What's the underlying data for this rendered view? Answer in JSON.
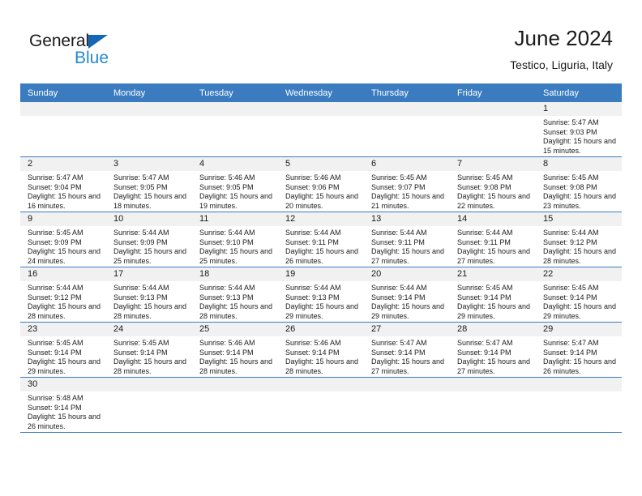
{
  "brand": {
    "name_top": "General",
    "name_bottom": "Blue",
    "triangle_color": "#1567b5",
    "blue_color": "#2389d6"
  },
  "header": {
    "title": "June 2024",
    "subtitle": "Testico, Liguria, Italy"
  },
  "theme": {
    "header_bg": "#3b7cc0",
    "header_text": "#ffffff",
    "daynum_band_bg": "#f1f1f1",
    "row_border": "#3b7cc0",
    "body_text": "#1a1a1a"
  },
  "weekday_headers": [
    "Sunday",
    "Monday",
    "Tuesday",
    "Wednesday",
    "Thursday",
    "Friday",
    "Saturday"
  ],
  "labels": {
    "sunrise_prefix": "Sunrise:",
    "sunset_prefix": "Sunset:",
    "daylight_prefix": "Daylight:"
  },
  "weeks": [
    [
      {
        "empty": true
      },
      {
        "empty": true
      },
      {
        "empty": true
      },
      {
        "empty": true
      },
      {
        "empty": true
      },
      {
        "empty": true
      },
      {
        "day": "1",
        "sunrise": "Sunrise: 5:47 AM",
        "sunset": "Sunset: 9:03 PM",
        "daylight": "Daylight: 15 hours and 15 minutes."
      }
    ],
    [
      {
        "day": "2",
        "sunrise": "Sunrise: 5:47 AM",
        "sunset": "Sunset: 9:04 PM",
        "daylight": "Daylight: 15 hours and 16 minutes."
      },
      {
        "day": "3",
        "sunrise": "Sunrise: 5:47 AM",
        "sunset": "Sunset: 9:05 PM",
        "daylight": "Daylight: 15 hours and 18 minutes."
      },
      {
        "day": "4",
        "sunrise": "Sunrise: 5:46 AM",
        "sunset": "Sunset: 9:05 PM",
        "daylight": "Daylight: 15 hours and 19 minutes."
      },
      {
        "day": "5",
        "sunrise": "Sunrise: 5:46 AM",
        "sunset": "Sunset: 9:06 PM",
        "daylight": "Daylight: 15 hours and 20 minutes."
      },
      {
        "day": "6",
        "sunrise": "Sunrise: 5:45 AM",
        "sunset": "Sunset: 9:07 PM",
        "daylight": "Daylight: 15 hours and 21 minutes."
      },
      {
        "day": "7",
        "sunrise": "Sunrise: 5:45 AM",
        "sunset": "Sunset: 9:08 PM",
        "daylight": "Daylight: 15 hours and 22 minutes."
      },
      {
        "day": "8",
        "sunrise": "Sunrise: 5:45 AM",
        "sunset": "Sunset: 9:08 PM",
        "daylight": "Daylight: 15 hours and 23 minutes."
      }
    ],
    [
      {
        "day": "9",
        "sunrise": "Sunrise: 5:45 AM",
        "sunset": "Sunset: 9:09 PM",
        "daylight": "Daylight: 15 hours and 24 minutes."
      },
      {
        "day": "10",
        "sunrise": "Sunrise: 5:44 AM",
        "sunset": "Sunset: 9:09 PM",
        "daylight": "Daylight: 15 hours and 25 minutes."
      },
      {
        "day": "11",
        "sunrise": "Sunrise: 5:44 AM",
        "sunset": "Sunset: 9:10 PM",
        "daylight": "Daylight: 15 hours and 25 minutes."
      },
      {
        "day": "12",
        "sunrise": "Sunrise: 5:44 AM",
        "sunset": "Sunset: 9:11 PM",
        "daylight": "Daylight: 15 hours and 26 minutes."
      },
      {
        "day": "13",
        "sunrise": "Sunrise: 5:44 AM",
        "sunset": "Sunset: 9:11 PM",
        "daylight": "Daylight: 15 hours and 27 minutes."
      },
      {
        "day": "14",
        "sunrise": "Sunrise: 5:44 AM",
        "sunset": "Sunset: 9:11 PM",
        "daylight": "Daylight: 15 hours and 27 minutes."
      },
      {
        "day": "15",
        "sunrise": "Sunrise: 5:44 AM",
        "sunset": "Sunset: 9:12 PM",
        "daylight": "Daylight: 15 hours and 28 minutes."
      }
    ],
    [
      {
        "day": "16",
        "sunrise": "Sunrise: 5:44 AM",
        "sunset": "Sunset: 9:12 PM",
        "daylight": "Daylight: 15 hours and 28 minutes."
      },
      {
        "day": "17",
        "sunrise": "Sunrise: 5:44 AM",
        "sunset": "Sunset: 9:13 PM",
        "daylight": "Daylight: 15 hours and 28 minutes."
      },
      {
        "day": "18",
        "sunrise": "Sunrise: 5:44 AM",
        "sunset": "Sunset: 9:13 PM",
        "daylight": "Daylight: 15 hours and 28 minutes."
      },
      {
        "day": "19",
        "sunrise": "Sunrise: 5:44 AM",
        "sunset": "Sunset: 9:13 PM",
        "daylight": "Daylight: 15 hours and 29 minutes."
      },
      {
        "day": "20",
        "sunrise": "Sunrise: 5:44 AM",
        "sunset": "Sunset: 9:14 PM",
        "daylight": "Daylight: 15 hours and 29 minutes."
      },
      {
        "day": "21",
        "sunrise": "Sunrise: 5:45 AM",
        "sunset": "Sunset: 9:14 PM",
        "daylight": "Daylight: 15 hours and 29 minutes."
      },
      {
        "day": "22",
        "sunrise": "Sunrise: 5:45 AM",
        "sunset": "Sunset: 9:14 PM",
        "daylight": "Daylight: 15 hours and 29 minutes."
      }
    ],
    [
      {
        "day": "23",
        "sunrise": "Sunrise: 5:45 AM",
        "sunset": "Sunset: 9:14 PM",
        "daylight": "Daylight: 15 hours and 29 minutes."
      },
      {
        "day": "24",
        "sunrise": "Sunrise: 5:45 AM",
        "sunset": "Sunset: 9:14 PM",
        "daylight": "Daylight: 15 hours and 28 minutes."
      },
      {
        "day": "25",
        "sunrise": "Sunrise: 5:46 AM",
        "sunset": "Sunset: 9:14 PM",
        "daylight": "Daylight: 15 hours and 28 minutes."
      },
      {
        "day": "26",
        "sunrise": "Sunrise: 5:46 AM",
        "sunset": "Sunset: 9:14 PM",
        "daylight": "Daylight: 15 hours and 28 minutes."
      },
      {
        "day": "27",
        "sunrise": "Sunrise: 5:47 AM",
        "sunset": "Sunset: 9:14 PM",
        "daylight": "Daylight: 15 hours and 27 minutes."
      },
      {
        "day": "28",
        "sunrise": "Sunrise: 5:47 AM",
        "sunset": "Sunset: 9:14 PM",
        "daylight": "Daylight: 15 hours and 27 minutes."
      },
      {
        "day": "29",
        "sunrise": "Sunrise: 5:47 AM",
        "sunset": "Sunset: 9:14 PM",
        "daylight": "Daylight: 15 hours and 26 minutes."
      }
    ],
    [
      {
        "day": "30",
        "sunrise": "Sunrise: 5:48 AM",
        "sunset": "Sunset: 9:14 PM",
        "daylight": "Daylight: 15 hours and 26 minutes."
      },
      {
        "empty": true
      },
      {
        "empty": true
      },
      {
        "empty": true
      },
      {
        "empty": true
      },
      {
        "empty": true
      },
      {
        "empty": true
      }
    ]
  ]
}
